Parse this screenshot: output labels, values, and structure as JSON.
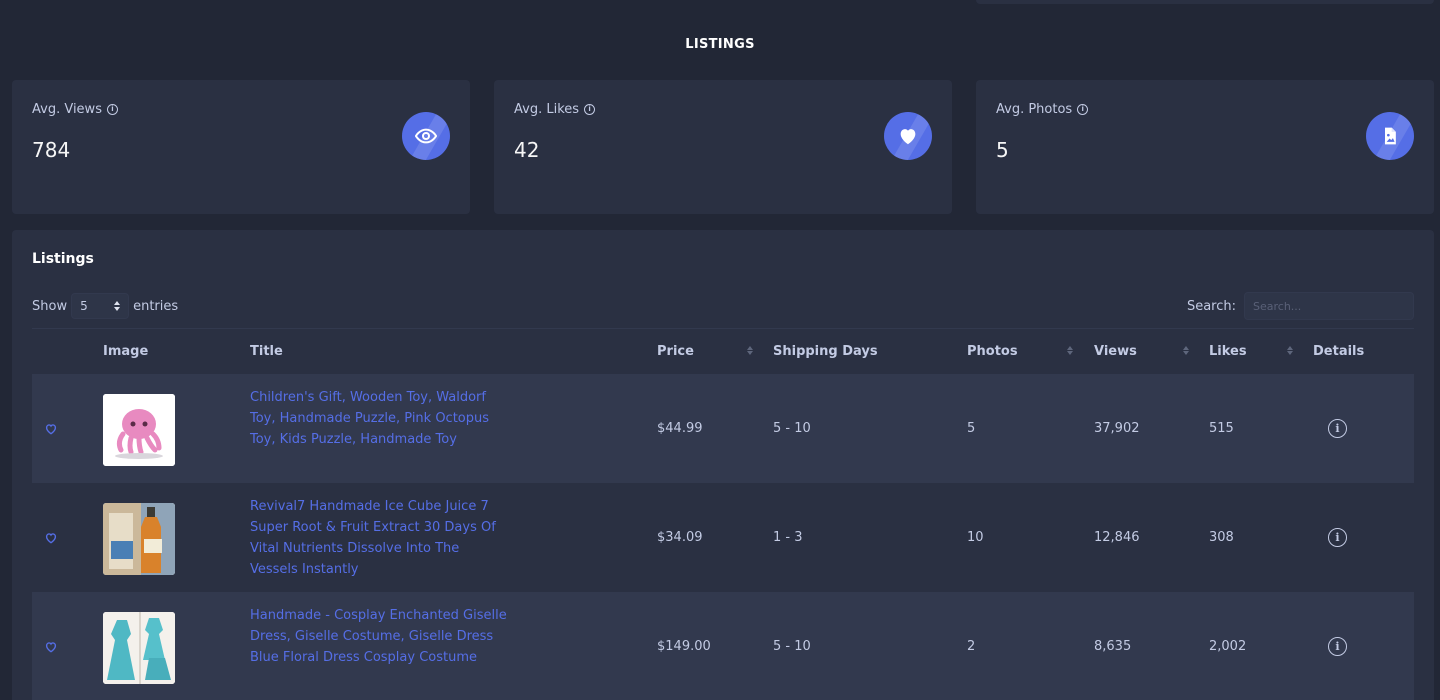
{
  "section_title": "LISTINGS",
  "stats": [
    {
      "label": "Avg. Views",
      "value": "784",
      "icon": "eye-icon"
    },
    {
      "label": "Avg. Likes",
      "value": "42",
      "icon": "heart-icon"
    },
    {
      "label": "Avg. Photos",
      "value": "5",
      "icon": "image-file-icon"
    }
  ],
  "colors": {
    "accent": "#556ee6",
    "background": "#222736",
    "card": "#2a3042",
    "row_stripe": "#32394e"
  },
  "listings": {
    "title": "Listings",
    "show_label": "Show",
    "entries_label": "entries",
    "page_size": "5",
    "search_label": "Search:",
    "search_placeholder": "Search...",
    "columns": [
      "Image",
      "Title",
      "Price",
      "Shipping Days",
      "Photos",
      "Views",
      "Likes",
      "Details"
    ],
    "rows": [
      {
        "title": "Children's Gift, Wooden Toy, Waldorf Toy, Handmade Puzzle, Pink Octopus Toy, Kids Puzzle, Handmade Toy",
        "price": "$44.99",
        "shipping_days": "5 - 10",
        "photos": "5",
        "views": "37,902",
        "likes": "515"
      },
      {
        "title": "Revival7 Handmade Ice Cube Juice 7 Super Root & Fruit Extract 30 Days Of Vital Nutrients Dissolve Into The Vessels Instantly",
        "price": "$34.09",
        "shipping_days": "1 - 3",
        "photos": "10",
        "views": "12,846",
        "likes": "308"
      },
      {
        "title": "Handmade - Cosplay Enchanted Giselle Dress, Giselle Costume, Giselle Dress Blue Floral Dress Cosplay Costume",
        "price": "$149.00",
        "shipping_days": "5 - 10",
        "photos": "2",
        "views": "8,635",
        "likes": "2,002"
      }
    ]
  }
}
